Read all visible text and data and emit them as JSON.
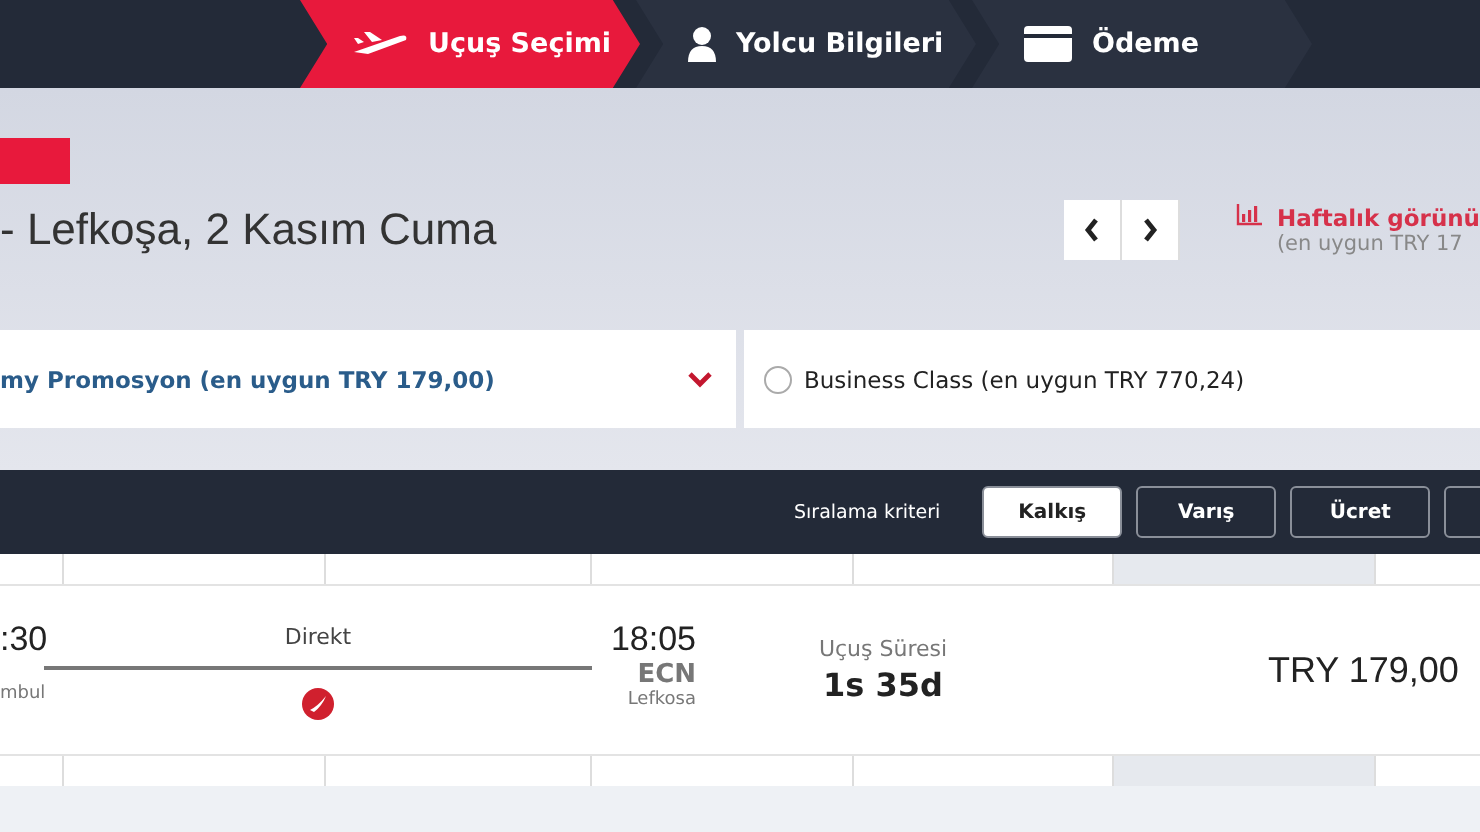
{
  "steps": [
    {
      "label": "Uçuş Seçimi",
      "kind": "plane",
      "selected": true
    },
    {
      "label": "Yolcu Bilgileri",
      "kind": "person",
      "selected": false
    },
    {
      "label": "Ödeme",
      "kind": "card",
      "selected": false
    }
  ],
  "route_title": "- Lefkoşa, 2 Kasım Cuma",
  "weekly_view": {
    "label": "Haftalık görünü",
    "note": "(en uygun TRY 17"
  },
  "cabin_options": [
    {
      "kind": "dropdown",
      "label": "my Promosyon (en uygun TRY 179,00)",
      "expanded": false
    },
    {
      "kind": "radio",
      "label": "Business Class (en uygun TRY 770,24)",
      "checked": false
    }
  ],
  "sort": {
    "label": "Sıralama kriteri",
    "options": [
      {
        "label": "Kalkış",
        "selected": true
      },
      {
        "label": "Varış",
        "selected": false
      },
      {
        "label": "Ücret",
        "selected": false
      }
    ]
  },
  "flight": {
    "departure_time": ":30",
    "departure_city": "mbul",
    "stops": "Direkt",
    "arrival_time": "18:05",
    "arrival_code": "ECN",
    "arrival_city": "Lefkosa",
    "duration_label": "Uçuş Süresi",
    "duration": "1s 35d",
    "price": "TRY 179,00"
  }
}
